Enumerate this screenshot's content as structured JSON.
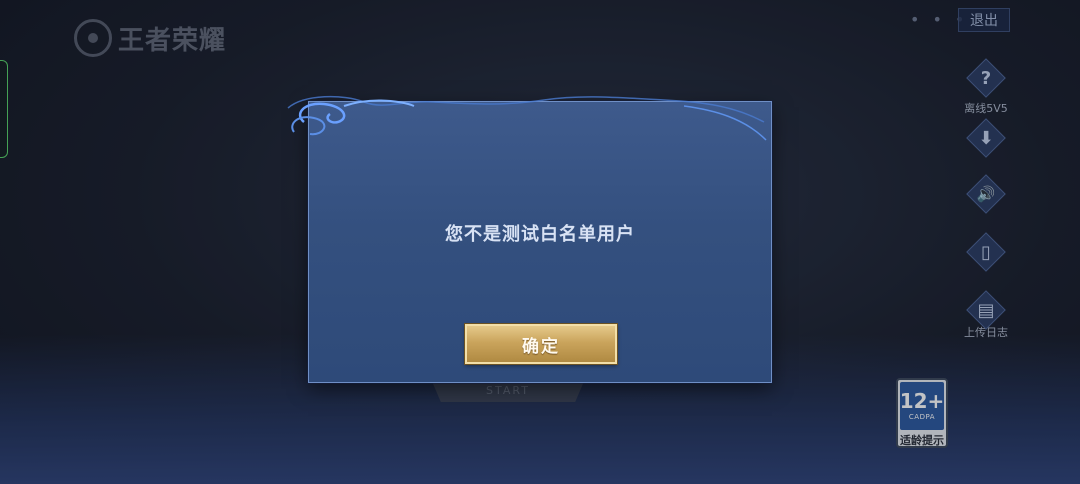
{
  "app": {
    "logo_text": "王者荣耀"
  },
  "header": {
    "more_dots": "• • •",
    "exit_label": "退出"
  },
  "sidebar": {
    "items": [
      {
        "icon": "question-icon",
        "glyph": "?",
        "label": "离线5V5"
      },
      {
        "icon": "download-icon",
        "glyph": "⬇",
        "label": ""
      },
      {
        "icon": "speaker-icon",
        "glyph": "🔊",
        "label": ""
      },
      {
        "icon": "phone-icon",
        "glyph": "▯",
        "label": ""
      },
      {
        "icon": "clipboard-icon",
        "glyph": "▤",
        "label": "上传日志"
      }
    ]
  },
  "start_button": {
    "label": "START"
  },
  "age_rating": {
    "number": "12+",
    "org": "CADPA",
    "label": "适龄提示"
  },
  "dialog": {
    "message": "您不是测试白名单用户",
    "confirm_label": "确定"
  },
  "colors": {
    "dialog_bg": "#34507f",
    "dialog_border": "#6f8fc6",
    "confirm_gold": "#caa45c",
    "age_badge_blue": "#2c5aa0"
  }
}
